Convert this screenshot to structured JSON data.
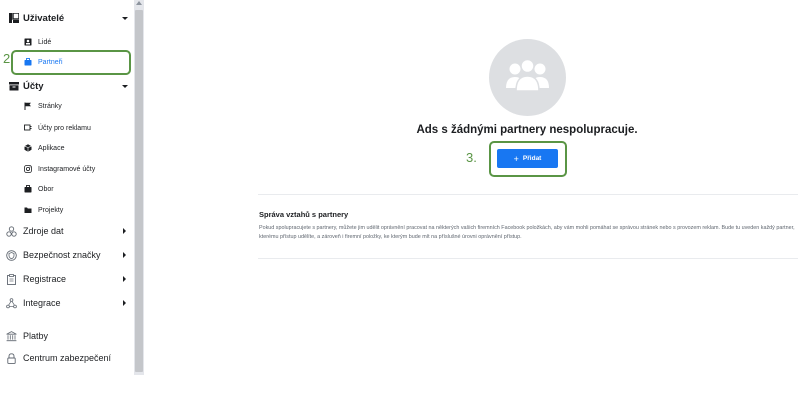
{
  "sidebar": {
    "users_section": {
      "label": "Uživatelé",
      "icon": "users-section-icon"
    },
    "users_items": [
      {
        "label": "Lidé",
        "icon": "person-card-icon"
      },
      {
        "label": "Partneři",
        "icon": "briefcase-icon",
        "active": true
      }
    ],
    "accounts_section": {
      "label": "Účty",
      "icon": "inbox-icon"
    },
    "accounts_items": [
      {
        "label": "Stránky",
        "icon": "flag-icon"
      },
      {
        "label": "Účty pro reklamu",
        "icon": "ad-account-icon"
      },
      {
        "label": "Aplikace",
        "icon": "cube-icon"
      },
      {
        "label": "Instagramové účty",
        "icon": "instagram-icon"
      },
      {
        "label": "Obor",
        "icon": "briefcase-icon"
      },
      {
        "label": "Projekty",
        "icon": "folder-icon"
      }
    ],
    "top_items": [
      {
        "label": "Zdroje dat",
        "icon": "data-sources-icon"
      },
      {
        "label": "Bezpečnost značky",
        "icon": "shield-icon"
      },
      {
        "label": "Registrace",
        "icon": "clipboard-icon"
      },
      {
        "label": "Integrace",
        "icon": "network-icon"
      },
      {
        "label": "Platby",
        "icon": "bank-icon"
      },
      {
        "label": "Centrum zabezpečení",
        "icon": "lock-icon"
      }
    ]
  },
  "annotations": {
    "step2": "2.",
    "step3": "3."
  },
  "main": {
    "empty_state_title": "Ads s žádnými partnery nespolupracuje.",
    "add_button_label": "Přidat",
    "add_button_plus": "+",
    "info_title": "Správa vztahů s partnery",
    "info_body": "Pokud spolupracujete s partnery, můžete jim udělit oprávnění pracovat na některých vašich firemních Facebook položkách, aby vám mohli pomáhat se správou stránek nebo s provozem reklam. Bude tu uveden každý partner, kterému přístup udělíte, a zároveň i firemní položky, ke kterým bude mít na příslušné úrovni oprávnění přístup."
  },
  "colors": {
    "accent": "#1877f2",
    "annotation_green": "#5a9545",
    "placeholder_gray": "#dddfe2"
  }
}
